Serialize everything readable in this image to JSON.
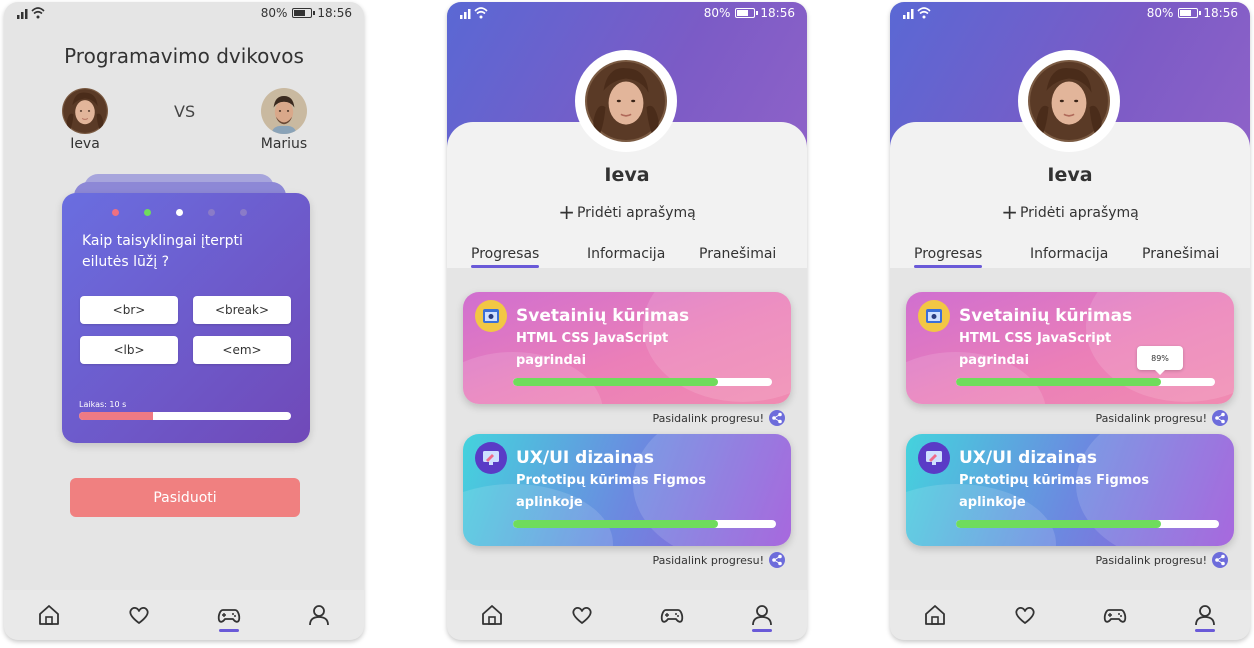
{
  "status": {
    "battery": "80%",
    "time": "18:56"
  },
  "duel": {
    "title": "Programavimo dvikovos",
    "player1": "Ieva",
    "vs": "VS",
    "player2": "Marius",
    "question": "Kaip taisyklingai įterpti eilutės lūžį ?",
    "answers": [
      "<br>",
      "<break>",
      "<lb>",
      "<em>"
    ],
    "timer_label": "Laikas: 10 s",
    "timer_progress": 0.35,
    "giveup": "Pasiduoti",
    "dots": [
      "#f07080",
      "#6fdc5c",
      "#ffffff",
      "#8a7bc8",
      "#8a7bc8"
    ]
  },
  "profile": {
    "name": "Ieva",
    "add_description": "Pridėti aprašymą",
    "tabs": [
      "Progresas",
      "Informacija",
      "Pranešimai"
    ],
    "courses": [
      {
        "title": "Svetainių kūrimas",
        "subtitle": "HTML CSS JavaScript pagrindai",
        "progress": 0.79
      },
      {
        "title": "UX/UI dizainas",
        "subtitle": "Prototipų kūrimas Figmos aplinkoje",
        "progress": 0.78
      }
    ],
    "share": "Pasidalink progresu!",
    "tooltip": "89%"
  },
  "nav": [
    "home-icon",
    "heart-icon",
    "gamepad-icon",
    "user-icon"
  ],
  "colors": {
    "accent": "#6a5ad8",
    "giveup": "#f08080",
    "progress": "#6fdc5c"
  }
}
